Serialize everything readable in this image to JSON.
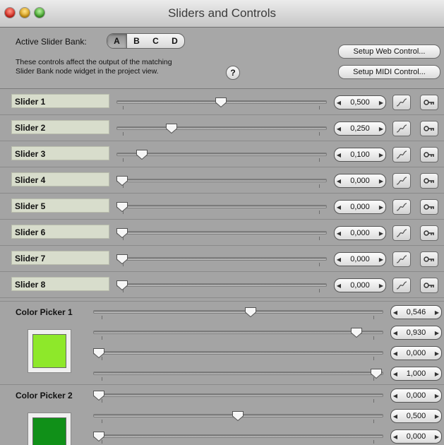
{
  "window": {
    "title": "Sliders and Controls"
  },
  "header": {
    "bank_label": "Active Slider Bank:",
    "banks": [
      "A",
      "B",
      "C",
      "D"
    ],
    "active_bank": "A",
    "description_line1": "These controls affect the output of the matching",
    "description_line2": "Slider Bank node widget in the project view.",
    "help_label": "?",
    "web_button": "Setup Web Control...",
    "midi_button": "Setup MIDI Control..."
  },
  "sliders": [
    {
      "name": "Slider 1",
      "value": 0.5,
      "display": "0,500"
    },
    {
      "name": "Slider 2",
      "value": 0.25,
      "display": "0,250"
    },
    {
      "name": "Slider 3",
      "value": 0.1,
      "display": "0,100"
    },
    {
      "name": "Slider 4",
      "value": 0.0,
      "display": "0,000"
    },
    {
      "name": "Slider 5",
      "value": 0.0,
      "display": "0,000"
    },
    {
      "name": "Slider 6",
      "value": 0.0,
      "display": "0,000"
    },
    {
      "name": "Slider 7",
      "value": 0.0,
      "display": "0,000"
    },
    {
      "name": "Slider 8",
      "value": 0.0,
      "display": "0,000"
    }
  ],
  "color_pickers": [
    {
      "name": "Color Picker 1",
      "swatch_color": "#8ee82a",
      "channels": [
        {
          "value": 0.546,
          "display": "0,546"
        },
        {
          "value": 0.93,
          "display": "0,930"
        },
        {
          "value": 0.0,
          "display": "0,000"
        },
        {
          "value": 1.0,
          "display": "1,000"
        }
      ]
    },
    {
      "name": "Color Picker 2",
      "swatch_color": "#109018",
      "channels": [
        {
          "value": 0.0,
          "display": "0,000"
        },
        {
          "value": 0.5,
          "display": "0,500"
        },
        {
          "value": 0.0,
          "display": "0,000"
        }
      ]
    }
  ],
  "icons": {
    "curve": "curve-icon",
    "key": "key-icon",
    "arrow_left": "left-arrow-icon",
    "arrow_right": "right-arrow-icon"
  }
}
